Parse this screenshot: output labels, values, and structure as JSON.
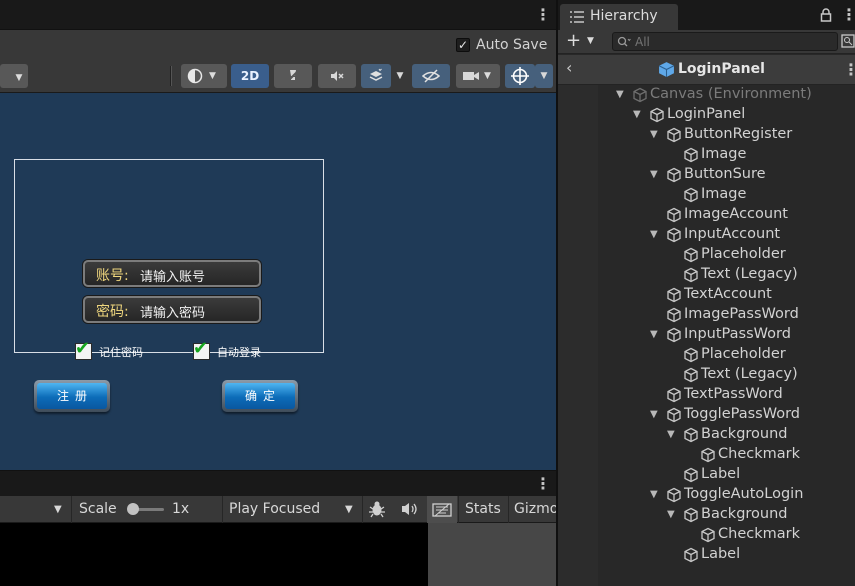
{
  "scene": {
    "autosave_label": "Auto Save",
    "autosave_checked": true,
    "mode_2d_label": "2D",
    "canvas": {
      "account_label": "账号:",
      "account_placeholder": "请输入账号",
      "password_label": "密码:",
      "password_placeholder": "请输入密码",
      "toggle_remember_label": "记住密码",
      "toggle_autologin_label": "自动登录",
      "button_register_label": "注册",
      "button_confirm_label": "确定"
    }
  },
  "game": {
    "scale_label": "Scale",
    "scale_value": "1x",
    "play_mode_label": "Play Focused",
    "stats_label": "Stats",
    "gizmos_label": "Gizmo"
  },
  "hierarchy": {
    "tab_label": "Hierarchy",
    "search_placeholder": "All",
    "header_title": "LoginPanel",
    "rows": [
      {
        "label": "Canvas (Environment)",
        "dim": true
      },
      {
        "label": "LoginPanel"
      },
      {
        "label": "ButtonRegister"
      },
      {
        "label": "Image"
      },
      {
        "label": "ButtonSure"
      },
      {
        "label": "Image"
      },
      {
        "label": "ImageAccount"
      },
      {
        "label": "InputAccount"
      },
      {
        "label": "Placeholder"
      },
      {
        "label": "Text (Legacy)"
      },
      {
        "label": "TextAccount"
      },
      {
        "label": "ImagePassWord"
      },
      {
        "label": "InputPassWord"
      },
      {
        "label": "Placeholder"
      },
      {
        "label": "Text (Legacy)"
      },
      {
        "label": "TextPassWord"
      },
      {
        "label": "TogglePassWord"
      },
      {
        "label": "Background"
      },
      {
        "label": "Checkmark"
      },
      {
        "label": "Label"
      },
      {
        "label": "ToggleAutoLogin"
      },
      {
        "label": "Background"
      },
      {
        "label": "Checkmark"
      },
      {
        "label": "Label"
      }
    ]
  },
  "colors": {
    "viewport_bg": "#1f3a57",
    "accent_blue": "#3a5e8c",
    "label_gold": "#f0d77e",
    "check_green": "#16a51e"
  },
  "icons": [
    "kebab-menu-icon",
    "lighting-sphere-icon",
    "chevron-down-icon",
    "audio-muted-icon",
    "effects-icon",
    "layers-icon",
    "visibility-off-icon",
    "camera-icon",
    "gizmo-crosshair-icon",
    "bug-icon",
    "speaker-icon",
    "keyboard-icon",
    "list-icon",
    "plus-icon",
    "search-icon",
    "lock-icon",
    "cube-icon",
    "chevron-left-icon",
    "triangle-down-icon"
  ]
}
